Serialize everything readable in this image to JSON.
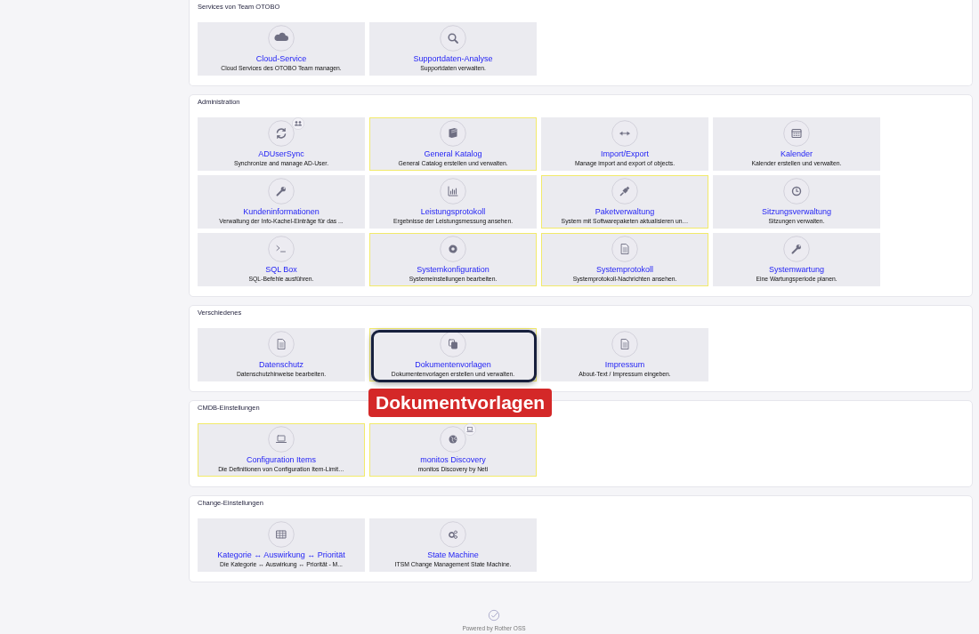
{
  "sections": [
    {
      "title": "Services von Team OTOBO",
      "tiles": [
        {
          "title": "Cloud-Service",
          "description": "Cloud Services des OTOBO Team managen.",
          "highlighted": false,
          "focused": false
        },
        {
          "title": "Supportdaten-Analyse",
          "description": "Supportdaten verwalten.",
          "highlighted": false,
          "focused": false
        }
      ]
    },
    {
      "title": "Administration",
      "tiles": [
        {
          "title": "ADUserSync",
          "description": "Synchronize and manage AD-User.",
          "highlighted": false,
          "focused": false
        },
        {
          "title": "General Katalog",
          "description": "General Catalog erstellen und verwalten.",
          "highlighted": true,
          "focused": false
        },
        {
          "title": "Import/Export",
          "description": "Manage import and export of objects.",
          "highlighted": false,
          "focused": false
        },
        {
          "title": "Kalender",
          "description": "Kalender erstellen und verwalten.",
          "highlighted": false,
          "focused": false
        },
        {
          "title": "Kundeninformationen",
          "description": "Verwaltung der Info-Kachel-Einträge für das ...",
          "highlighted": false,
          "focused": false
        },
        {
          "title": "Leistungsprotokoll",
          "description": "Ergebnisse der Leistungsmessung ansehen.",
          "highlighted": false,
          "focused": false
        },
        {
          "title": "Paketverwaltung",
          "description": "System mit Softwarepaketen aktualisieren un…",
          "highlighted": true,
          "focused": false
        },
        {
          "title": "Sitzungsverwaltung",
          "description": "Sitzungen verwalten.",
          "highlighted": false,
          "focused": false
        },
        {
          "title": "SQL Box",
          "description": "SQL-Befehle ausführen.",
          "highlighted": false,
          "focused": false
        },
        {
          "title": "Systemkonfiguration",
          "description": "Systemeinstellungen bearbeiten.",
          "highlighted": true,
          "focused": false
        },
        {
          "title": "Systemprotokoll",
          "description": "Systemprotokoll-Nachrichten ansehen.",
          "highlighted": true,
          "focused": false
        },
        {
          "title": "Systemwartung",
          "description": "Eine Wartungsperiode planen.",
          "highlighted": false,
          "focused": false
        }
      ]
    },
    {
      "title": "Verschiedenes",
      "tiles": [
        {
          "title": "Datenschutz",
          "description": "Datenschutzhinweise bearbeiten.",
          "highlighted": false,
          "focused": false
        },
        {
          "title": "Dokumentenvorlagen",
          "description": "Dokumentenvorlagen erstellen und verwalten.",
          "highlighted": true,
          "focused": true,
          "callout": "Dokumentvorlagen"
        },
        {
          "title": "Impressum",
          "description": "About-Text / Impressum eingeben.",
          "highlighted": false,
          "focused": false
        }
      ]
    },
    {
      "title": "CMDB-Einstellungen",
      "tiles": [
        {
          "title": "Configuration Items",
          "description": "Die Definitionen von Configuration Item-Limit…",
          "highlighted": true,
          "focused": false
        },
        {
          "title": "monitos Discovery",
          "description": "monitos Discovery by Neti",
          "highlighted": true,
          "focused": false
        }
      ]
    },
    {
      "title": "Change-Einstellungen",
      "tiles": [
        {
          "title": "Kategorie ↔ Auswirkung ↔ Priorität",
          "description": "Die Kategorie ↔ Auswirkung ↔ Priorität - M...",
          "highlighted": false,
          "focused": false
        },
        {
          "title": "State Machine",
          "description": "ITSM Change Management State Machine.",
          "highlighted": false,
          "focused": false
        }
      ]
    }
  ],
  "footer": {
    "text": "Powered by Rother OSS"
  }
}
